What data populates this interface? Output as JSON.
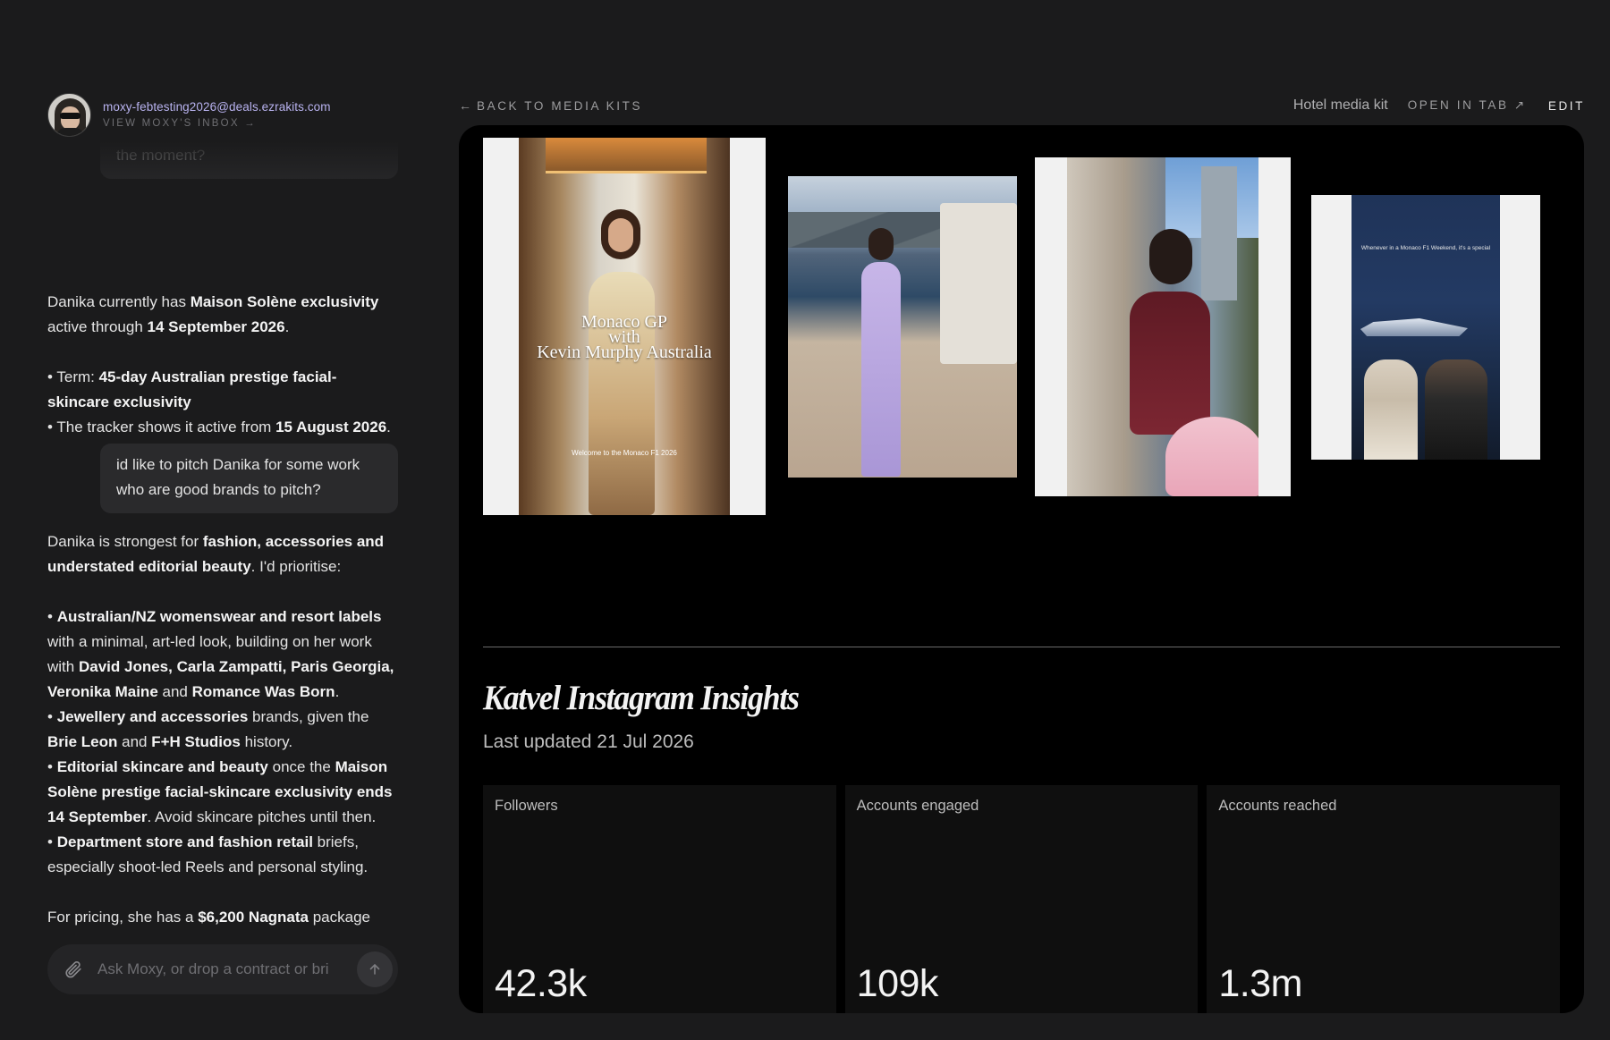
{
  "agent": {
    "email": "moxy-febtesting2026@deals.ezrakits.com",
    "inbox_link": "VIEW MOXY'S INBOX →"
  },
  "chat": {
    "partial_bubble": "the moment?",
    "msg1": {
      "p1": [
        "Danika currently has ",
        "Maison Solène exclusivity",
        " active through ",
        "14 September 2026",
        "."
      ],
      "p2a": [
        "• Term: ",
        "45-day Australian prestige facial-skincare exclusivity"
      ],
      "p2b": [
        "• The tracker shows it active from ",
        "15 August 2026",
        "."
      ]
    },
    "user_bubble": "id like to pitch Danika for some work who are good brands to pitch?",
    "msg2": {
      "p1": [
        "Danika is strongest for ",
        "fashion, accessories and understated editorial beauty",
        ". I'd prioritise:"
      ],
      "b1": [
        "• ",
        "Australian/NZ womenswear and resort labels",
        " with a minimal, art-led look, building on her work with ",
        "David Jones, Carla Zampatti, Paris Georgia, Veronika Maine",
        " and ",
        "Romance Was Born",
        "."
      ],
      "b2": [
        "• ",
        "Jewellery and accessories",
        " brands, given the ",
        "Brie Leon",
        " and ",
        "F+H Studios",
        " history."
      ],
      "b3": [
        "• ",
        "Editorial skincare and beauty",
        " once the ",
        "Maison Solène prestige facial-skincare exclusivity ends 14 September",
        ". Avoid skincare pitches until then."
      ],
      "b4": [
        "• ",
        "Department store and fashion retail",
        " briefs, especially shoot-led Reels and personal styling."
      ],
      "p_last": [
        "For pricing, she has a ",
        "$6,200 Nagnata",
        " package"
      ]
    },
    "composer_placeholder": "Ask Moxy, or drop a contract or bri"
  },
  "topbar": {
    "back_label": "BACK TO MEDIA KITS",
    "kit_label": "Hotel media kit",
    "open_tab_label": "OPEN IN TAB ↗",
    "edit_label": "EDIT"
  },
  "media": {
    "photo1_caption_lines": [
      "Monaco GP",
      "with",
      "Kevin Murphy Australia"
    ],
    "photo1_subcaption": "Welcome to the Monaco F1 2026",
    "photo4_overlay": "Whenever in a Monaco F1 Weekend, it's a special"
  },
  "insights": {
    "title": "Katvel Instagram Insights",
    "updated": "Last updated 21 Jul 2026",
    "stats": [
      {
        "label": "Followers",
        "value": "42.3k"
      },
      {
        "label": "Accounts engaged",
        "value": "109k"
      },
      {
        "label": "Accounts reached",
        "value": "1.3m"
      }
    ]
  },
  "icons": {
    "back": "arrow-left-icon",
    "attach": "paperclip-icon",
    "send": "arrow-up-icon"
  }
}
